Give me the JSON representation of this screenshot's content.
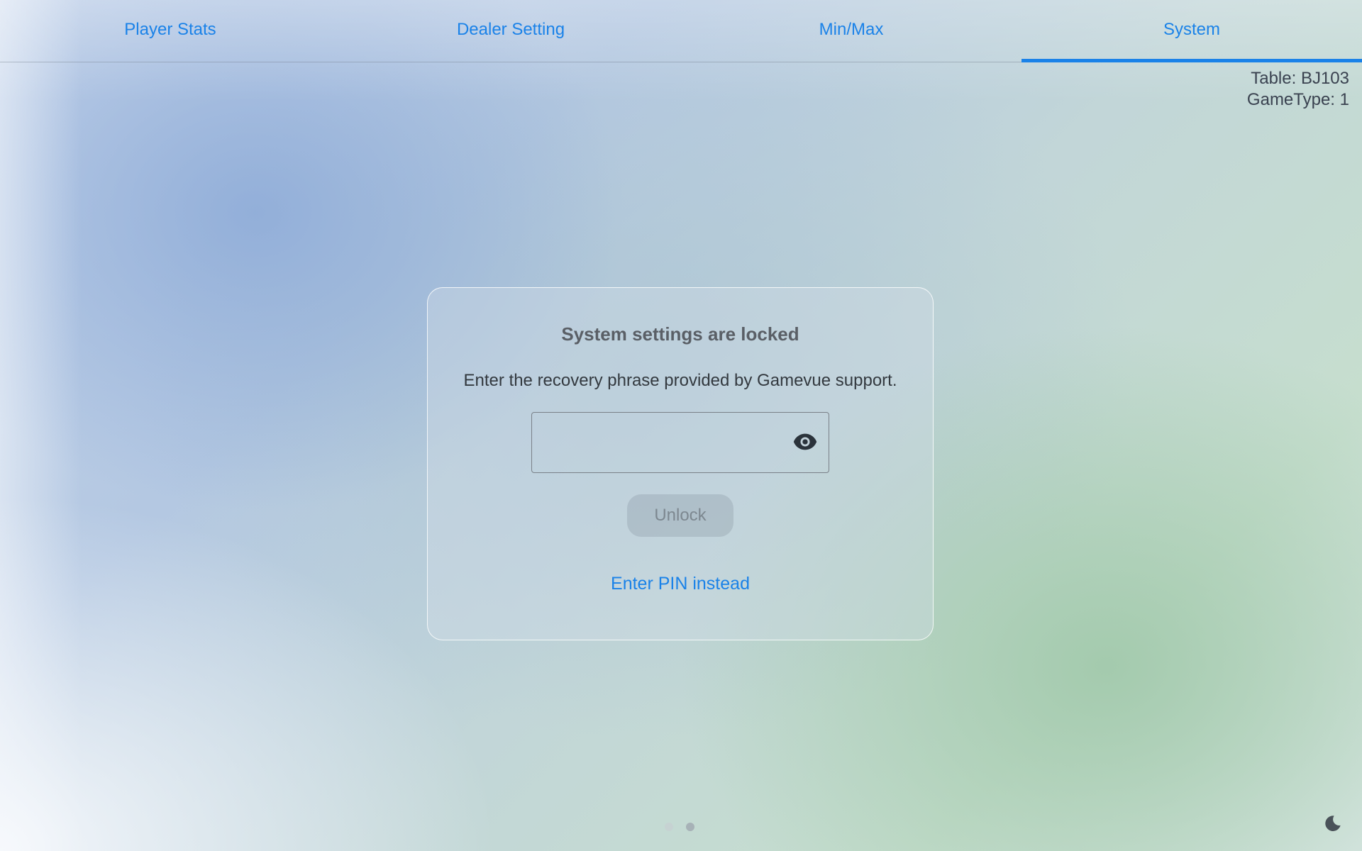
{
  "tabs": [
    {
      "label": "Player Stats",
      "active": false
    },
    {
      "label": "Dealer Setting",
      "active": false
    },
    {
      "label": "Min/Max",
      "active": false
    },
    {
      "label": "System",
      "active": true
    }
  ],
  "table_info": {
    "table": "Table: BJ103",
    "game_type": "GameType: 1"
  },
  "lock_card": {
    "title": "System settings are locked",
    "description": "Enter the recovery phrase provided by Gamevue support.",
    "phrase_input": {
      "value": "",
      "placeholder": ""
    },
    "unlock_label": "Unlock",
    "pin_link_label": "Enter PIN instead"
  },
  "pager": {
    "count": 2,
    "active_index": 1
  },
  "icons": {
    "visibility": "eye-icon",
    "theme_toggle": "moon-icon"
  },
  "colors": {
    "accent": "#1a82e8",
    "text_dark": "#33393f",
    "title_gray": "#5a5f66",
    "disabled_text": "#7d8890"
  }
}
